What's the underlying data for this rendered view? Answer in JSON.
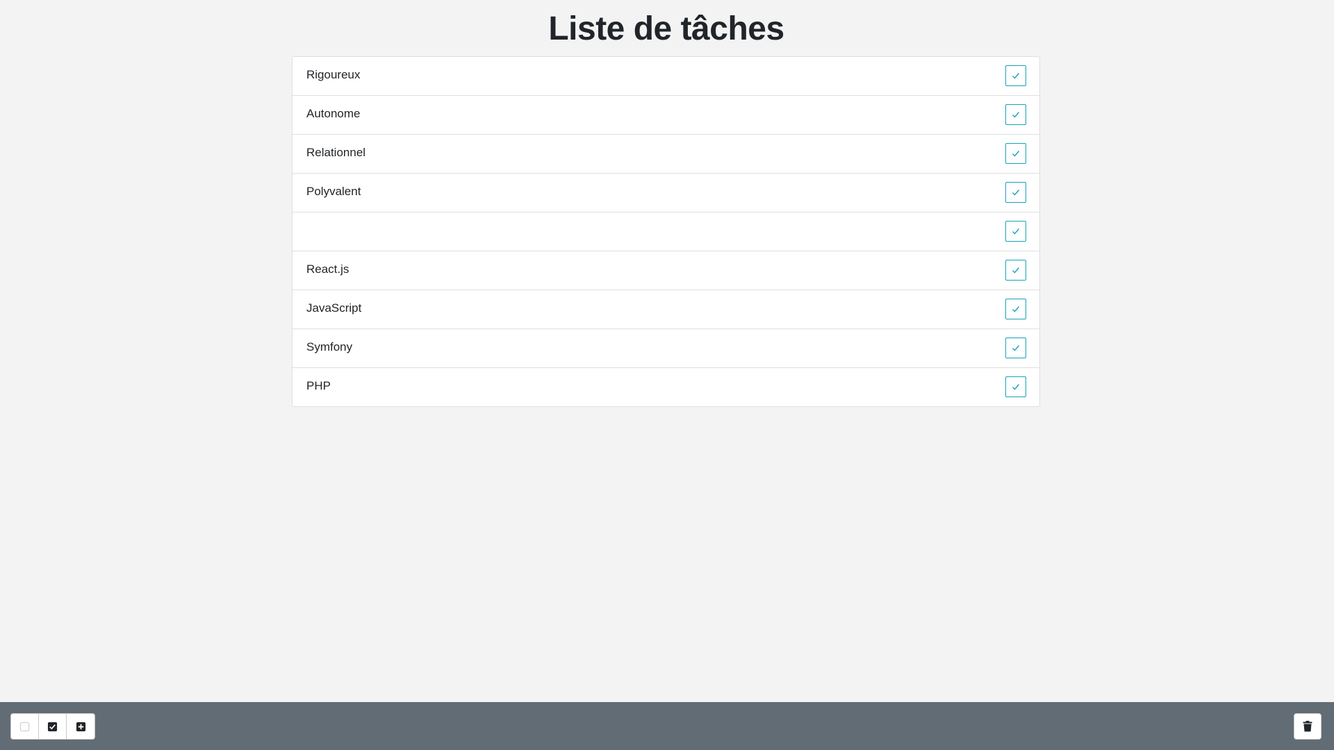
{
  "page": {
    "title": "Liste de tâches"
  },
  "tasks": [
    {
      "label": "Rigoureux",
      "checked": true
    },
    {
      "label": "Autonome",
      "checked": true
    },
    {
      "label": "Relationnel",
      "checked": true
    },
    {
      "label": "Polyvalent",
      "checked": true
    },
    {
      "label": "",
      "checked": true
    },
    {
      "label": "React.js",
      "checked": true
    },
    {
      "label": "JavaScript",
      "checked": true
    },
    {
      "label": "Symfony",
      "checked": true
    },
    {
      "label": "PHP",
      "checked": true
    }
  ],
  "footer": {
    "buttons": [
      {
        "name": "filter-all-button",
        "icon": "square-outline-icon",
        "state": "disabled"
      },
      {
        "name": "filter-done-button",
        "icon": "check-square-icon",
        "state": "active"
      },
      {
        "name": "add-task-button",
        "icon": "plus-square-icon",
        "state": "active"
      }
    ],
    "trash": {
      "icon": "trash-icon"
    }
  },
  "colors": {
    "accent": "#17a2b8",
    "background": "#f3f3f3",
    "footer": "#626c75",
    "text": "#212529",
    "border": "#dfdfdf"
  }
}
